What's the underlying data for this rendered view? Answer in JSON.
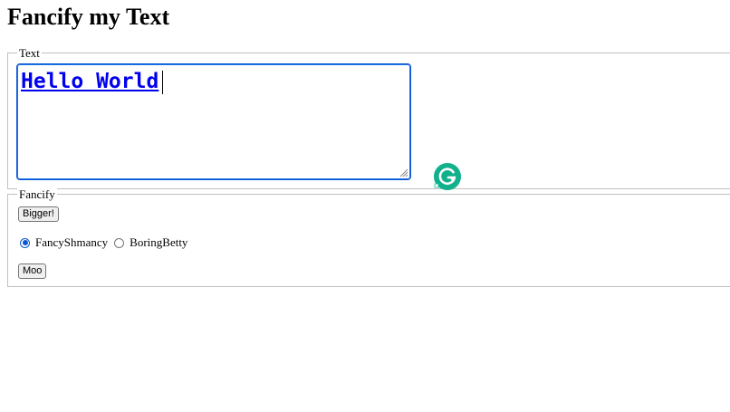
{
  "page": {
    "title": "Fancify my Text"
  },
  "text_section": {
    "legend": "Text",
    "textarea_value": "Hello World"
  },
  "fancify_section": {
    "legend": "Fancify",
    "bigger_button_label": "Bigger!",
    "radio_options": [
      {
        "label": "FancyShmancy",
        "checked": true
      },
      {
        "label": "BoringBetty",
        "checked": false
      }
    ],
    "moo_button_label": "Moo"
  },
  "colors": {
    "textarea_text": "#0000ee",
    "focus_border": "#0b57d0",
    "grammarly_green": "#15c39a"
  },
  "icons": {
    "grammarly": "grammarly-icon",
    "resize": "resize-handle-icon"
  }
}
